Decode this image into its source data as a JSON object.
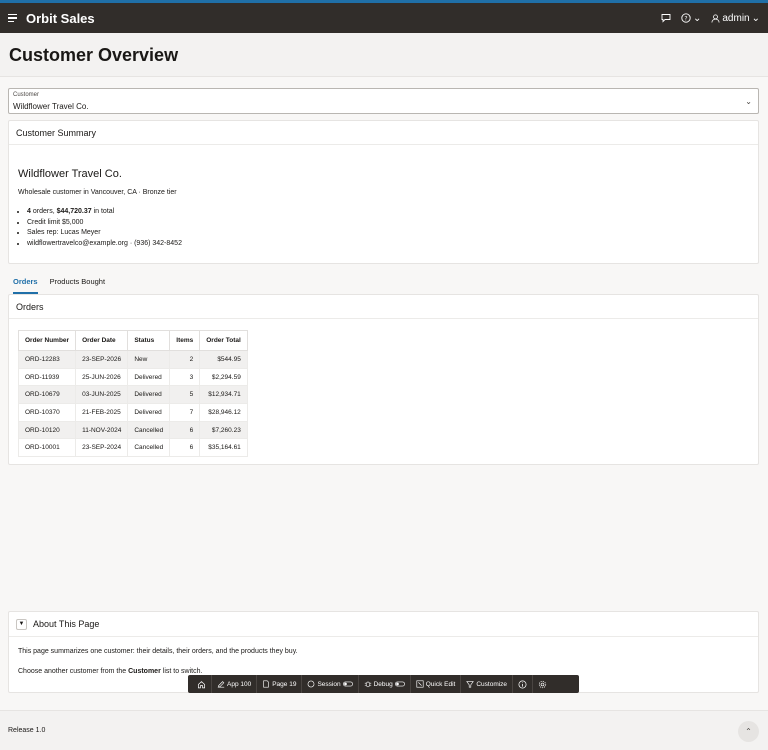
{
  "app": {
    "title": "Orbit Sales",
    "user": "admin"
  },
  "header_icons": {
    "chat": "chat-icon",
    "help": "help-icon",
    "user": "user-icon"
  },
  "page": {
    "title": "Customer Overview"
  },
  "customer_select": {
    "label": "Customer",
    "value": "Wildflower Travel Co."
  },
  "summary": {
    "heading": "Customer Summary",
    "name": "Wildflower Travel Co.",
    "description": "Wholesale customer in Vancouver, CA · Bronze tier",
    "orders_count": "4",
    "orders_text": " orders, ",
    "orders_total": "$44,720.37",
    "orders_suffix": " in total",
    "credit": "Credit limit $5,000",
    "rep": "Sales rep: Lucas Meyer",
    "contact": "wildflowertravelco@example.org · (936) 342-8452"
  },
  "tabs": [
    {
      "label": "Orders",
      "active": true
    },
    {
      "label": "Products Bought",
      "active": false
    }
  ],
  "orders": {
    "heading": "Orders",
    "columns": [
      "Order Number",
      "Order Date",
      "Status",
      "Items",
      "Order Total"
    ],
    "rows": [
      [
        "ORD-12283",
        "23-SEP-2026",
        "New",
        "2",
        "$544.95"
      ],
      [
        "ORD-11939",
        "25-JUN-2026",
        "Delivered",
        "3",
        "$2,294.59"
      ],
      [
        "ORD-10679",
        "03-JUN-2025",
        "Delivered",
        "5",
        "$12,934.71"
      ],
      [
        "ORD-10370",
        "21-FEB-2025",
        "Delivered",
        "7",
        "$28,946.12"
      ],
      [
        "ORD-10120",
        "11-NOV-2024",
        "Cancelled",
        "6",
        "$7,260.23"
      ],
      [
        "ORD-10001",
        "23-SEP-2024",
        "Cancelled",
        "6",
        "$35,164.61"
      ]
    ]
  },
  "about": {
    "heading": "About This Page",
    "p1": "This page summarizes one customer: their details, their orders, and the products they buy.",
    "p2_prefix": "Choose another customer from the ",
    "p2_bold": "Customer",
    "p2_suffix": " list to switch."
  },
  "devbar": {
    "app": "App 100",
    "page": "Page 19",
    "session": "Session",
    "debug": "Debug",
    "quick_edit": "Quick Edit",
    "customize": "Customize"
  },
  "footer": {
    "release": "Release 1.0"
  }
}
